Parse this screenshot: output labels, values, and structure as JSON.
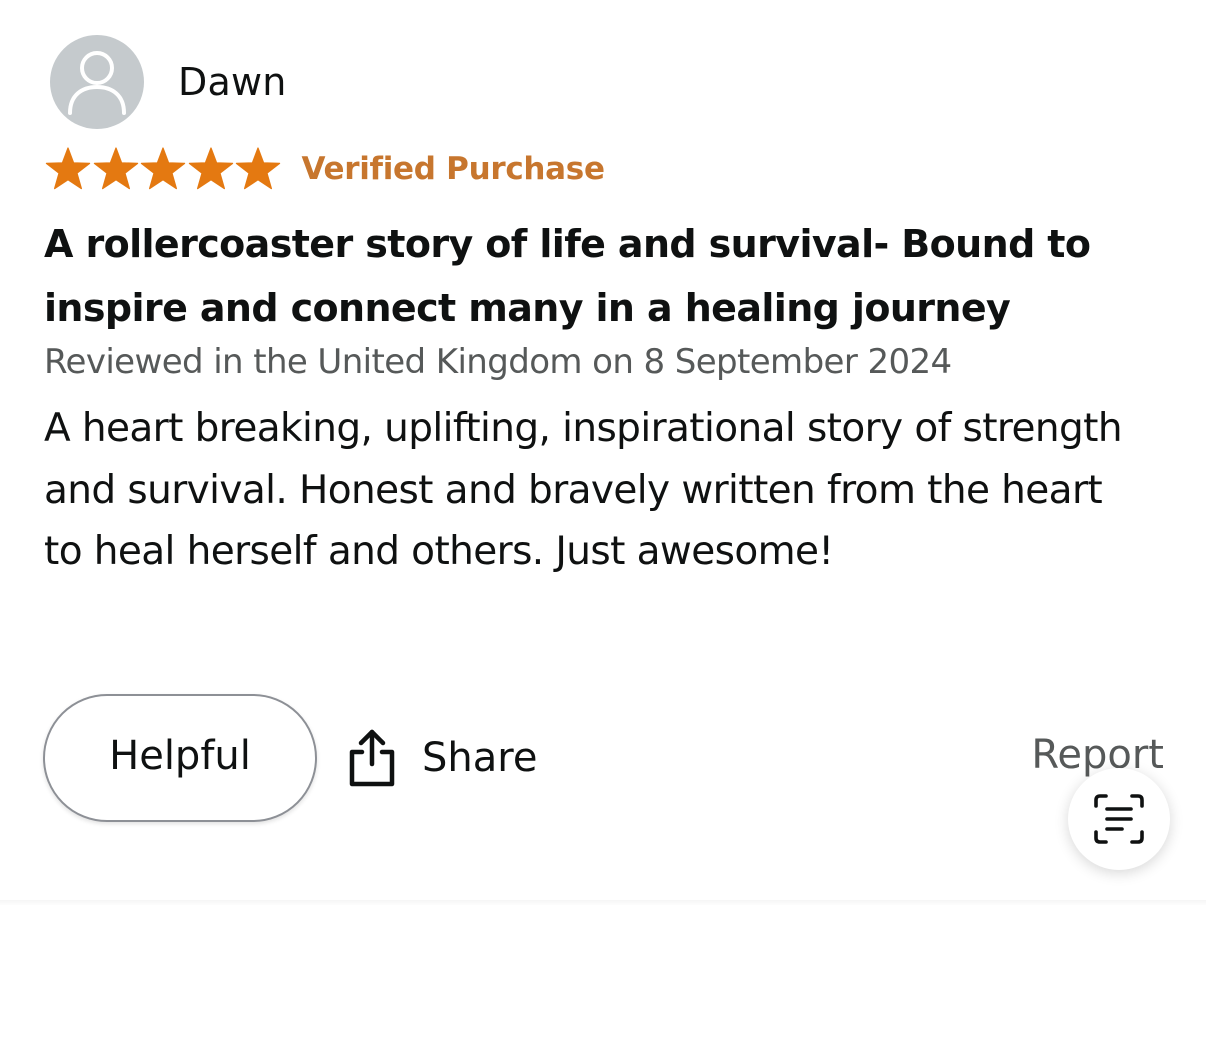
{
  "review": {
    "reviewer_name": "Dawn",
    "rating": 5,
    "rating_max": 5,
    "star_color": "#e47911",
    "verified_label": "Verified Purchase",
    "verified_color": "#c7762e",
    "title": "A rollercoaster story of life and survival- Bound to inspire and connect many in a healing journey",
    "meta": "Reviewed in the United Kingdom on 8 September 2024",
    "body": "A heart breaking, uplifting, inspirational story of strength and survival. Honest and bravely written from the heart to heal herself and others. Just awesome!"
  },
  "actions": {
    "helpful_label": "Helpful",
    "share_label": "Share",
    "report_label": "Report"
  },
  "icons": {
    "avatar": "person-silhouette-icon",
    "share": "share-upload-icon",
    "scan": "text-scan-icon"
  }
}
